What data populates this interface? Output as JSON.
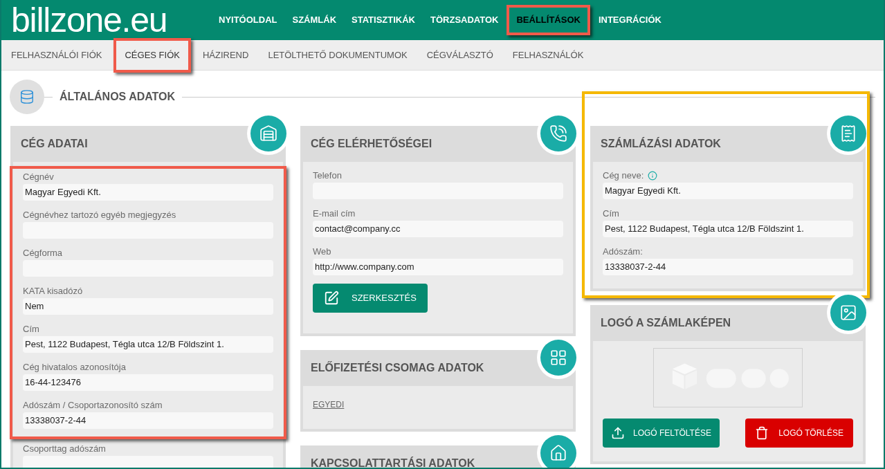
{
  "brand": {
    "logo": "billzone.eu"
  },
  "main_nav": [
    {
      "label": "NYITÓOLDAL",
      "selected": false,
      "highlighted": false
    },
    {
      "label": "SZÁMLÁK",
      "selected": false,
      "highlighted": false
    },
    {
      "label": "STATISZTIKÁK",
      "selected": false,
      "highlighted": false
    },
    {
      "label": "TÖRZSADATOK",
      "selected": false,
      "highlighted": false
    },
    {
      "label": "BEÁLLÍTÁSOK",
      "selected": true,
      "highlighted": true
    },
    {
      "label": "INTEGRÁCIÓK",
      "selected": false,
      "highlighted": false
    }
  ],
  "sub_nav": [
    {
      "label": "FELHASZNÁLÓI FIÓK",
      "selected": false,
      "highlighted": false
    },
    {
      "label": "CÉGES FIÓK",
      "selected": true,
      "highlighted": true
    },
    {
      "label": "HÁZIREND",
      "selected": false,
      "highlighted": false
    },
    {
      "label": "LETÖLTHETŐ DOKUMENTUMOK",
      "selected": false,
      "highlighted": false
    },
    {
      "label": "CÉGVÁLASZTÓ",
      "selected": false,
      "highlighted": false
    },
    {
      "label": "FELHASZNÁLÓK",
      "selected": false,
      "highlighted": false
    }
  ],
  "section": {
    "title": "ÁLTALÁNOS ADATOK"
  },
  "columns": [
    [
      {
        "kind": "form",
        "title": "CÉG ADATAI",
        "highlighted": false,
        "field_groups": [
          {
            "highlighted": true,
            "fields": [
              {
                "label": "Cégnév",
                "value": "Magyar Egyedi Kft."
              },
              {
                "label": "Cégnévhez tartozó egyéb megjegyzés"
              },
              {
                "label": "Cégforma"
              },
              {
                "label": "KATA kisadózó",
                "value": "Nem"
              },
              {
                "label": "Cím",
                "value": "Pest, 1122 Budapest, Tégla utca 12/B Földszint 1."
              },
              {
                "label": "Cég hivatalos azonosítója",
                "value": "16-44-123476"
              },
              {
                "label": "Adószám / Csoportazonosító szám",
                "value": "13338037-2-44"
              }
            ]
          },
          {
            "highlighted": false,
            "fields": [
              {
                "label": "Csoporttag adószám"
              }
            ]
          }
        ]
      }
    ],
    [
      {
        "kind": "form",
        "title": "CÉG ELÉRHETŐSÉGEI",
        "highlighted": false,
        "field_groups": [
          {
            "highlighted": false,
            "fields": [
              {
                "label": "Telefon"
              },
              {
                "label": "E-mail cím",
                "value": "contact@company.cc"
              },
              {
                "label": "Web",
                "value": "http://www.company.com"
              }
            ]
          }
        ],
        "button": {
          "label": "SZERKESZTÉS"
        }
      },
      {
        "kind": "link",
        "title": "ELŐFIZETÉSI CSOMAG ADATOK",
        "highlighted": false,
        "link": "EGYEDI"
      },
      {
        "kind": "empty",
        "title": "KAPCSOLATTARTÁSI ADATOK",
        "highlighted": false
      }
    ],
    [
      {
        "kind": "form",
        "title": "SZÁMLÁZÁSI ADATOK",
        "highlighted": true,
        "field_groups": [
          {
            "highlighted": false,
            "fields": [
              {
                "label": "Cég neve:",
                "info": true,
                "value": "Magyar Egyedi Kft."
              },
              {
                "label": "Cím",
                "value": "Pest, 1122 Budapest, Tégla utca 12/B Földszint 1."
              },
              {
                "label": "Adószám:",
                "value": "13338037-2-44"
              }
            ]
          }
        ]
      },
      {
        "kind": "logo",
        "title": "LOGÓ A SZÁMLAKÉPEN",
        "highlighted": false,
        "logo_image": {
          "kind": "picture"
        },
        "buttons": [
          {
            "kind": "upload",
            "label": "LOGÓ FELTÖLTÉSE"
          },
          {
            "kind": "delete",
            "label": "LOGÓ TÖRLÉSE"
          }
        ]
      }
    ]
  ]
}
